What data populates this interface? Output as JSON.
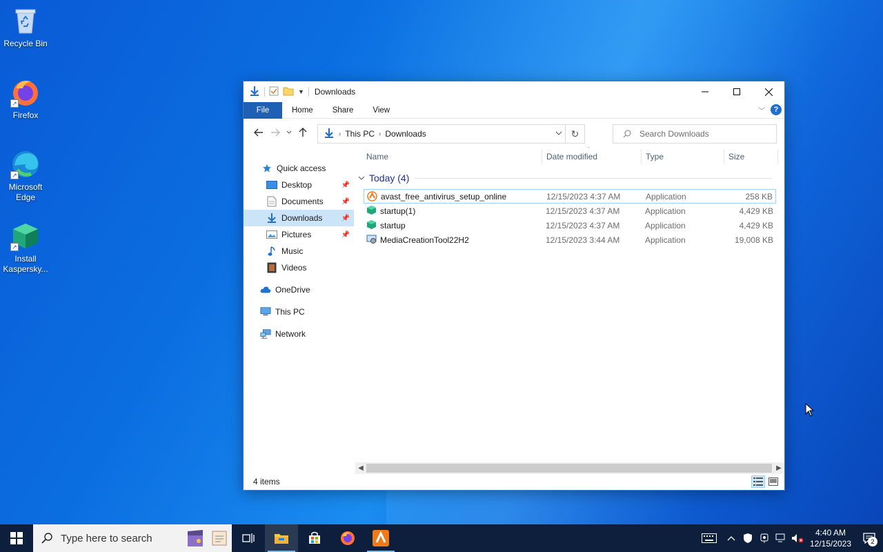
{
  "desktop": {
    "icons": [
      {
        "label": "Recycle Bin"
      },
      {
        "label": "Firefox"
      },
      {
        "label": "Microsoft Edge"
      },
      {
        "label": "Install Kaspersky..."
      }
    ]
  },
  "window": {
    "title": "Downloads",
    "ribbon_tabs": [
      "File",
      "Home",
      "Share",
      "View"
    ],
    "address": {
      "segments": [
        "This PC",
        "Downloads"
      ]
    },
    "search_placeholder": "Search Downloads",
    "nav_pane": {
      "quick_access": "Quick access",
      "items": [
        {
          "label": "Desktop",
          "pinned": true
        },
        {
          "label": "Documents",
          "pinned": true
        },
        {
          "label": "Downloads",
          "pinned": true,
          "selected": true
        },
        {
          "label": "Pictures",
          "pinned": true
        },
        {
          "label": "Music",
          "pinned": false
        },
        {
          "label": "Videos",
          "pinned": false
        }
      ],
      "onedrive": "OneDrive",
      "this_pc": "This PC",
      "network": "Network"
    },
    "columns": [
      "Name",
      "Date modified",
      "Type",
      "Size"
    ],
    "group": "Today (4)",
    "files": [
      {
        "name": "avast_free_antivirus_setup_online",
        "date": "12/15/2023 4:37 AM",
        "type": "Application",
        "size": "258 KB"
      },
      {
        "name": "startup(1)",
        "date": "12/15/2023 4:37 AM",
        "type": "Application",
        "size": "4,429 KB"
      },
      {
        "name": "startup",
        "date": "12/15/2023 4:37 AM",
        "type": "Application",
        "size": "4,429 KB"
      },
      {
        "name": "MediaCreationTool22H2",
        "date": "12/15/2023 3:44 AM",
        "type": "Application",
        "size": "19,008 KB"
      }
    ],
    "status": "4 items"
  },
  "taskbar": {
    "search_placeholder": "Type here to search",
    "time": "4:40 AM",
    "date": "12/15/2023",
    "notification_count": "2"
  },
  "colors": {
    "accent": "#1f5fb4",
    "selection": "#cce4f7",
    "group_header": "#1e3287"
  }
}
